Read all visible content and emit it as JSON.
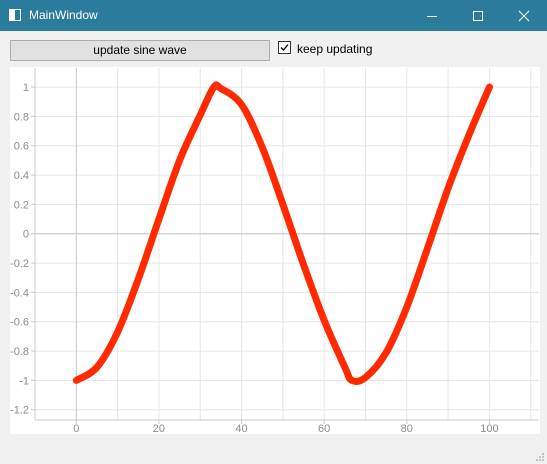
{
  "window": {
    "title": "MainWindow",
    "icon": "window-icon",
    "controls": [
      "minimize-icon",
      "maximize-icon",
      "close-icon"
    ]
  },
  "toolbar": {
    "update_button_label": "update sine wave",
    "keep_updating_label": "keep updating",
    "keep_updating_checked": true
  },
  "colors": {
    "titlebar": "#2b7c9c",
    "curve": "#ff2a00",
    "grid": "#e6e6e6",
    "axis": "#c8c8c8",
    "tick_label": "#8c8c8c"
  },
  "chart_data": {
    "type": "line",
    "title": "",
    "xlabel": "",
    "ylabel": "",
    "xlim": [
      -10,
      112
    ],
    "ylim": [
      -1.27,
      1.13
    ],
    "xticks": [
      0,
      20,
      40,
      60,
      80,
      100
    ],
    "xtick_labels": [
      "0",
      "20",
      "40",
      "60",
      "80",
      "100"
    ],
    "yticks": [
      1,
      0.8,
      0.6,
      0.4,
      0.2,
      0,
      -0.2,
      -0.4,
      -0.6,
      -0.8,
      -1,
      -1.2
    ],
    "ytick_labels": [
      "1",
      "0.8",
      "0.6",
      "0.4",
      "0.2",
      "0",
      "-0.2",
      "-0.4",
      "-0.6",
      "-0.8",
      "-1",
      "-1.2"
    ],
    "grid": true,
    "legend": "none",
    "series": [
      {
        "x": [
          0,
          5,
          10,
          15,
          20,
          25,
          30,
          33.3,
          35,
          40,
          45,
          50,
          55,
          60,
          65,
          66.7,
          70,
          75,
          80,
          85,
          90,
          95,
          100
        ],
        "y": [
          -1,
          -0.91,
          -0.67,
          -0.31,
          0.1,
          0.5,
          0.81,
          1,
          0.99,
          0.88,
          0.59,
          0.2,
          -0.21,
          -0.59,
          -0.91,
          -1,
          -0.98,
          -0.81,
          -0.5,
          -0.1,
          0.31,
          0.67,
          1
        ]
      }
    ]
  }
}
